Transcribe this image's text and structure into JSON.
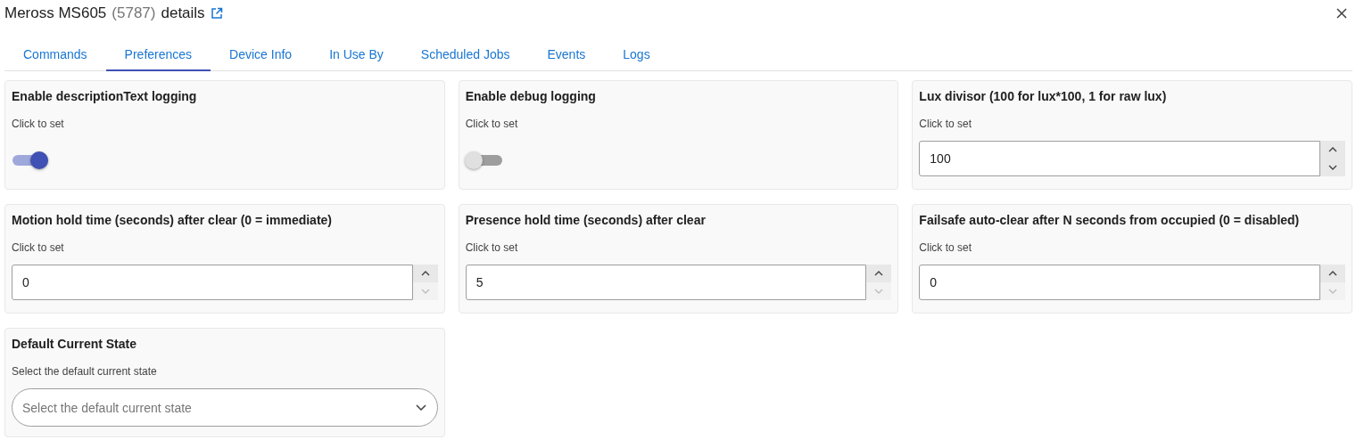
{
  "header": {
    "title": "Meross MS605",
    "id": "(5787)",
    "suffix": "details"
  },
  "tabs": [
    {
      "label": "Commands",
      "selected": false
    },
    {
      "label": "Preferences",
      "selected": true
    },
    {
      "label": "Device Info",
      "selected": false
    },
    {
      "label": "In Use By",
      "selected": false
    },
    {
      "label": "Scheduled Jobs",
      "selected": false
    },
    {
      "label": "Events",
      "selected": false
    },
    {
      "label": "Logs",
      "selected": false
    }
  ],
  "preferences": [
    {
      "kind": "toggle",
      "title": "Enable descriptionText logging",
      "hint": "Click to set",
      "on": true
    },
    {
      "kind": "toggle",
      "title": "Enable debug logging",
      "hint": "Click to set",
      "on": false
    },
    {
      "kind": "number",
      "title": "Lux divisor (100 for lux*100, 1 for raw lux)",
      "hint": "Click to set",
      "value": "100",
      "down_disabled": false
    },
    {
      "kind": "number",
      "title": "Motion hold time (seconds) after clear (0 = immediate)",
      "hint": "Click to set",
      "value": "0",
      "down_disabled": true
    },
    {
      "kind": "number",
      "title": "Presence hold time (seconds) after clear",
      "hint": "Click to set",
      "value": "5",
      "down_disabled": true
    },
    {
      "kind": "number",
      "title": "Failsafe auto-clear after N seconds from occupied (0 = disabled)",
      "hint": "Click to set",
      "value": "0",
      "down_disabled": true
    },
    {
      "kind": "select",
      "title": "Default Current State",
      "hint": "Select the default current state",
      "placeholder": "Select the default current state"
    }
  ]
}
